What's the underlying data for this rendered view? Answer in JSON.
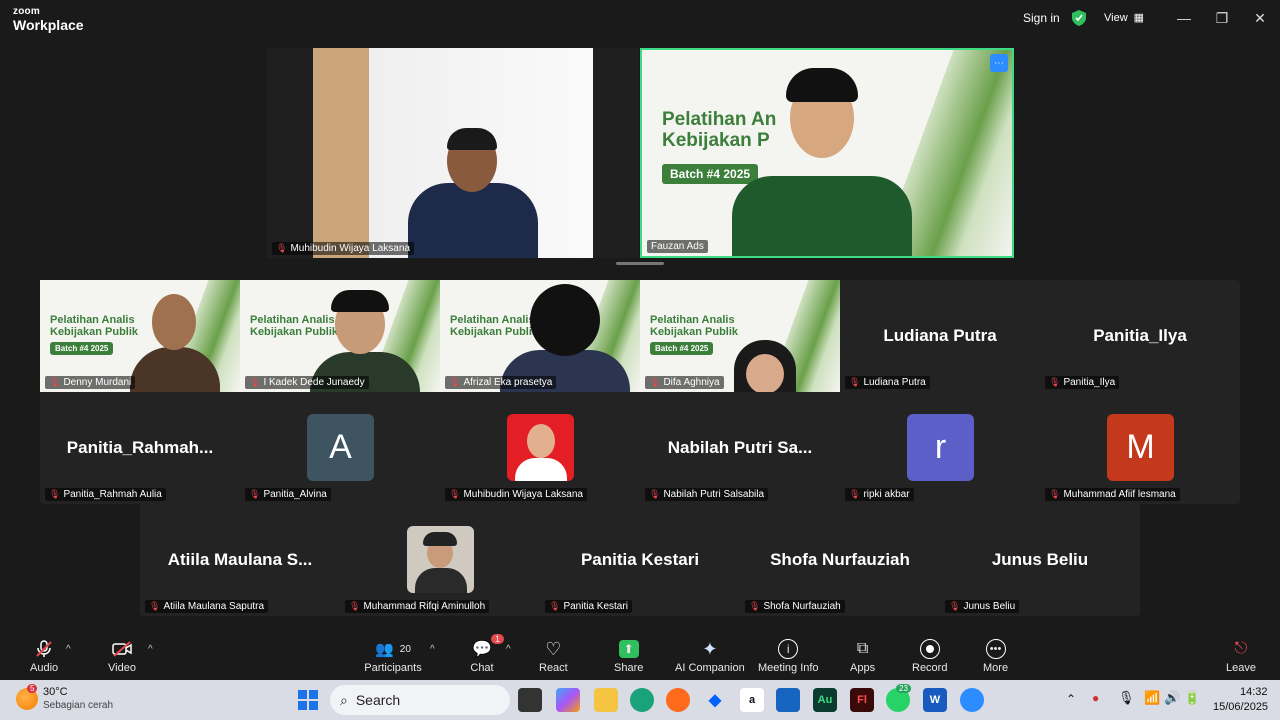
{
  "app": {
    "logo_line1": "zoom",
    "logo_line2": "Workplace",
    "sign_in": "Sign in",
    "view": "View"
  },
  "speakers": [
    {
      "name": "Muhibudin Wijaya Laksana"
    },
    {
      "name": "Fauzan Ads",
      "banner_title_1": "Pelatihan An",
      "banner_title_2": "Kebijakan P",
      "batch": "Batch #4 2025"
    }
  ],
  "grid": {
    "row1": [
      {
        "name": "Denny Murdani",
        "type": "video"
      },
      {
        "name": "I Kadek Dede Junaedy",
        "type": "video"
      },
      {
        "name": "Afrizal Eka prasetya",
        "type": "video"
      },
      {
        "name": "Difa Aghniya",
        "type": "video"
      },
      {
        "name": "Ludiana Putra",
        "big": "Ludiana Putra",
        "type": "text"
      },
      {
        "name": "Panitia_Ilya",
        "big": "Panitia_Ilya",
        "type": "text"
      }
    ],
    "row2": [
      {
        "name": "Panitia_Rahmah Aulia",
        "big": "Panitia_Rahmah...",
        "type": "text"
      },
      {
        "name": "Panitia_Alvina",
        "letter": "A",
        "color": "#3f5461",
        "type": "avatar"
      },
      {
        "name": "Muhibudin Wijaya Laksana",
        "type": "photo"
      },
      {
        "name": "Nabilah Putri Salsabila",
        "big": "Nabilah Putri Sa...",
        "type": "text"
      },
      {
        "name": "ripki akbar",
        "letter": "r",
        "color": "#5b5fc7",
        "type": "avatar"
      },
      {
        "name": "Muhammad Afiif lesmana",
        "letter": "M",
        "color": "#c4391c",
        "type": "avatar"
      }
    ],
    "row3": [
      {
        "name": "Atiila Maulana Saputra",
        "big": "Atiila Maulana S...",
        "type": "text"
      },
      {
        "name": "Muhammad Rifqi Aminulloh",
        "type": "photo"
      },
      {
        "name": "Panitia Kestari",
        "big": "Panitia Kestari",
        "type": "text"
      },
      {
        "name": "Shofa Nurfauziah",
        "big": "Shofa Nurfauziah",
        "type": "text"
      },
      {
        "name": "Junus Beliu",
        "big": "Junus Beliu",
        "type": "text"
      }
    ],
    "banner_title_1": "Pelatihan Analis",
    "banner_title_2": "Kebijakan Publik",
    "batch": "Batch #4 2025"
  },
  "toolbar": {
    "audio": "Audio",
    "video": "Video",
    "participants": "Participants",
    "participants_count": "20",
    "chat": "Chat",
    "chat_badge": "1",
    "react": "React",
    "share": "Share",
    "ai_companion": "AI Companion",
    "meeting_info": "Meeting Info",
    "apps": "Apps",
    "record": "Record",
    "more": "More",
    "leave": "Leave"
  },
  "taskbar": {
    "weather_temp": "30°C",
    "weather_desc": "Sebagian cerah",
    "weather_badge": "5",
    "search": "Search",
    "whatsapp_badge": "23",
    "time": "14:32",
    "date": "15/06/2025"
  },
  "colors": {
    "accent_green": "#3ddc84",
    "share_green": "#2fbf5f",
    "mic_off": "#e5484d",
    "chat_badge": "#e5484d"
  }
}
